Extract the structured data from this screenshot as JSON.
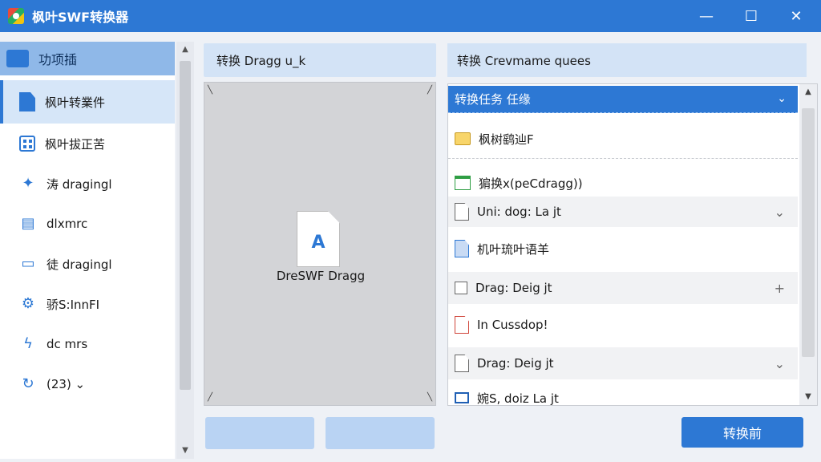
{
  "window": {
    "title": "枫叶SWF转换器",
    "min": "—",
    "max": "☐",
    "close": "✕"
  },
  "sidebar": {
    "header": "功项插",
    "items": [
      {
        "label": "枫叶转業件",
        "icon": "document-icon",
        "active": true
      },
      {
        "label": "枫叶拔正苦",
        "icon": "grid-icon"
      },
      {
        "label": "涛 dragingl",
        "icon": "sparkle-icon"
      },
      {
        "label": "dlxmrc",
        "icon": "file-edit-icon"
      },
      {
        "label": "徒 dragingl",
        "icon": "monitor-icon"
      },
      {
        "label": "骄S:InnFI",
        "icon": "gear-icon"
      },
      {
        "label": "dc mrs",
        "icon": "lightning-gear-icon"
      },
      {
        "label": "(23) ⌄",
        "icon": "refresh-icon"
      }
    ]
  },
  "middle": {
    "header": "转换 Dragg u_k",
    "drop_label": "DreSWF Dragg",
    "file_glyph": "A"
  },
  "queue": {
    "header": "转换 Crevmame quees",
    "group_header": "转换任务 任缘",
    "rows": [
      {
        "label": "枫树鹞辿F",
        "icon": "folder-icon",
        "action": "",
        "gray": false
      },
      {
        "label": "猏换x(peCdragg))",
        "icon": "image-file-icon",
        "action": "",
        "gray": false
      },
      {
        "label": "Uni: dog: La jt",
        "icon": "file-icon",
        "action": "⌄",
        "gray": true
      },
      {
        "label": "机叶琉叶语羊",
        "icon": "blue-file-icon",
        "action": "",
        "gray": false
      },
      {
        "label": "Drag: Deig jt",
        "icon": "checkbox-icon",
        "action": "+",
        "gray": true
      },
      {
        "label": "In Cussdop!",
        "icon": "red-file-icon",
        "action": "",
        "gray": false
      },
      {
        "label": "Drag: Deig jt",
        "icon": "file-icon",
        "action": "⌄",
        "gray": true
      },
      {
        "label": "婉S, doiz La jt",
        "icon": "window-icon",
        "action": "",
        "gray": false
      }
    ]
  },
  "convert_button": "转换前"
}
